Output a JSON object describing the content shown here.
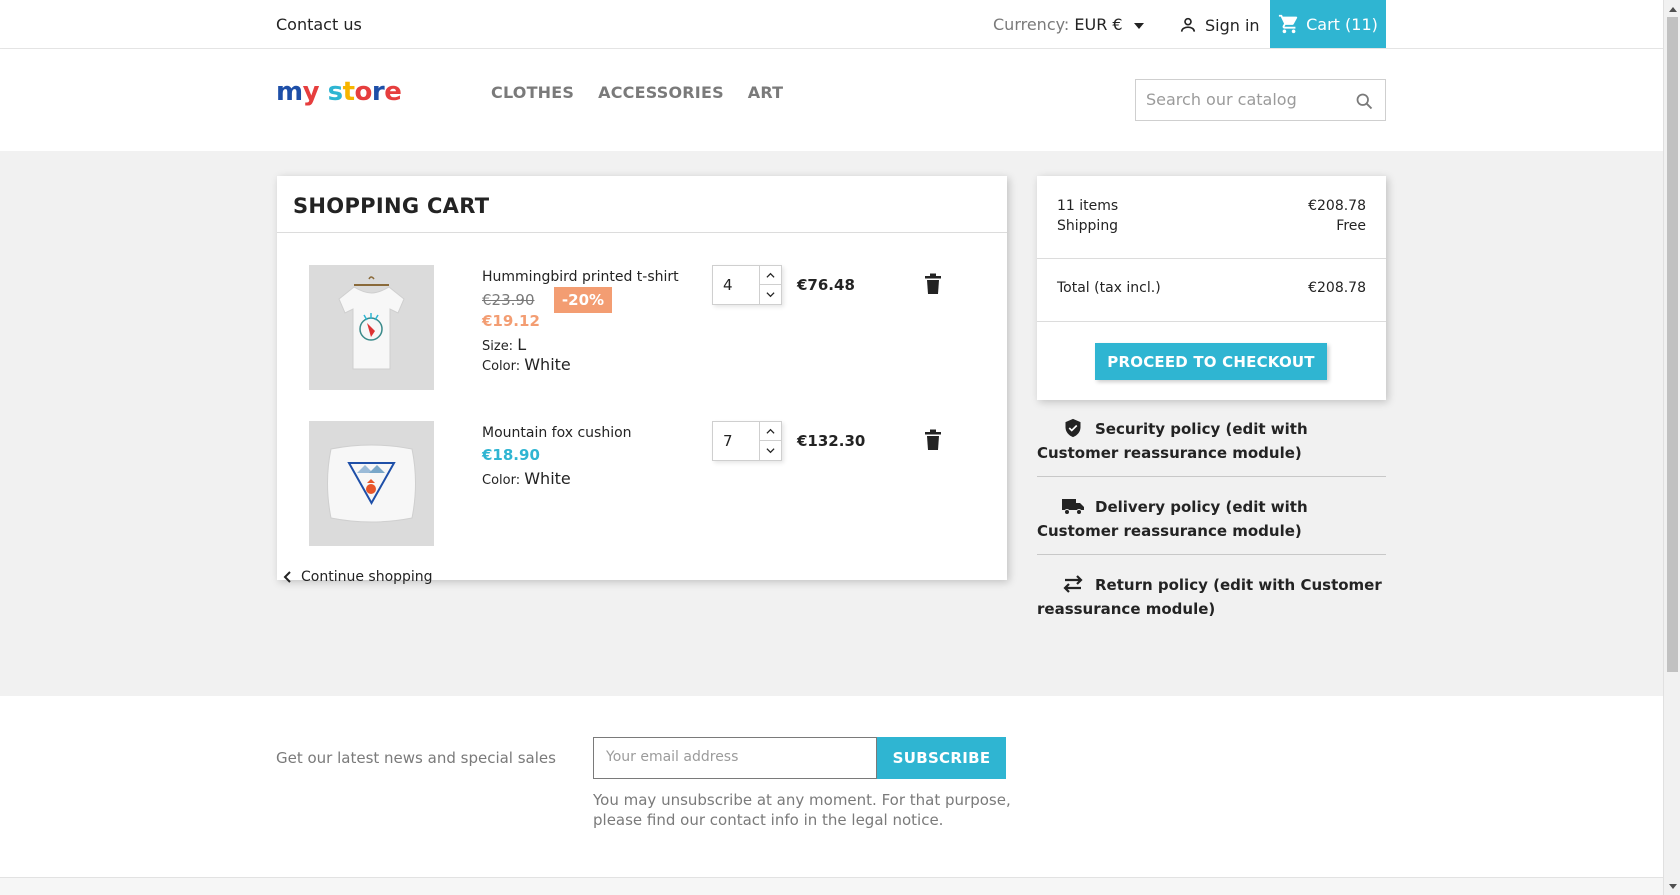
{
  "topbar": {
    "contact": "Contact us",
    "currency_label": "Currency:",
    "currency_value": "EUR €",
    "signin": "Sign in",
    "cart": "Cart (11)"
  },
  "header": {
    "logo": {
      "letters": [
        "m",
        "y",
        " ",
        "s",
        "t",
        "o",
        "r",
        "e"
      ],
      "colors": [
        "#1e4fa8",
        "#e63e3e",
        "#fff",
        "#2fb5d2",
        "#f7b500",
        "#e63e3e",
        "#1e4fa8",
        "#e63e3e"
      ]
    },
    "menu": [
      "CLOTHES",
      "ACCESSORIES",
      "ART"
    ],
    "search_placeholder": "Search our catalog"
  },
  "cart": {
    "title": "SHOPPING CART",
    "items": [
      {
        "name": "Hummingbird printed t-shirt",
        "old_price": "€23.90",
        "discount": "-20%",
        "price": "€19.12",
        "size_label": "Size:",
        "size": "L",
        "color_label": "Color:",
        "color": "White",
        "quantity": "4",
        "total": "€76.48",
        "image_icon": "tshirt-icon"
      },
      {
        "name": "Mountain fox cushion",
        "price": "€18.90",
        "color_label": "Color:",
        "color": "White",
        "quantity": "7",
        "total": "€132.30",
        "image_icon": "cushion-icon"
      }
    ],
    "continue": "Continue shopping"
  },
  "summary": {
    "items_label": "11 items",
    "items_value": "€208.78",
    "shipping_label": "Shipping",
    "shipping_value": "Free",
    "total_label": "Total (tax incl.)",
    "total_value": "€208.78",
    "checkout": "PROCEED TO CHECKOUT"
  },
  "reassurance": [
    {
      "icon": "shield-check-icon",
      "line1": "Security policy (edit with",
      "line2": "Customer reassurance module)"
    },
    {
      "icon": "truck-icon",
      "line1": "Delivery policy (edit with",
      "line2": "Customer reassurance module)"
    },
    {
      "icon": "swap-arrows-icon",
      "line1": "Return policy (edit with Customer",
      "line2": "reassurance module)"
    }
  ],
  "newsletter": {
    "label": "Get our latest news and special sales",
    "email_placeholder": "Your email address",
    "subscribe": "SUBSCRIBE",
    "note": "You may unsubscribe at any moment. For that purpose, please find our contact info in the legal notice."
  },
  "colors": {
    "accent": "#2fb5d2",
    "discount": "#f39d72",
    "background": "#f1f1f1"
  }
}
